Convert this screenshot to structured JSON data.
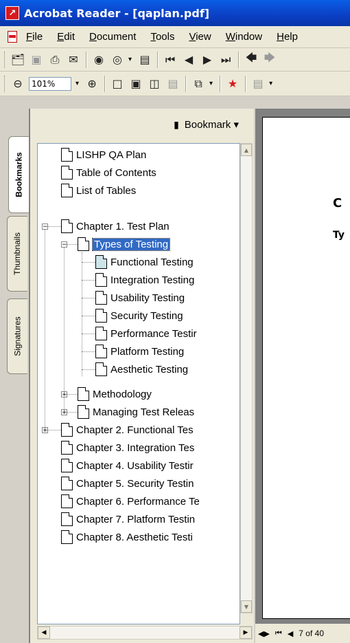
{
  "window": {
    "title": "Acrobat Reader - [qaplan.pdf]"
  },
  "menu": [
    {
      "label": "File",
      "u": "F",
      "rest": "ile"
    },
    {
      "label": "Edit",
      "u": "E",
      "rest": "dit"
    },
    {
      "label": "Document",
      "u": "D",
      "rest": "ocument"
    },
    {
      "label": "Tools",
      "u": "T",
      "rest": "ools"
    },
    {
      "label": "View",
      "u": "V",
      "rest": "iew"
    },
    {
      "label": "Window",
      "u": "W",
      "rest": "indow"
    },
    {
      "label": "Help",
      "u": "H",
      "rest": "elp"
    }
  ],
  "toolbar2": {
    "zoom": "101%"
  },
  "tabs": {
    "bookmarks": "Bookmarks",
    "thumbnails": "Thumbnails",
    "signatures": "Signatures"
  },
  "bookmarks_panel": {
    "menu_label": "Bookmark ▾"
  },
  "bookmarks": [
    {
      "label": "LISHP QA Plan"
    },
    {
      "label": "Table of Contents"
    },
    {
      "label": "List of Tables"
    },
    {
      "label": "Chapter 1. Test Plan"
    },
    {
      "label": "Types of Testing"
    },
    {
      "label": "Functional Testing"
    },
    {
      "label": "Integration Testing"
    },
    {
      "label": "Usability Testing"
    },
    {
      "label": "Security Testing"
    },
    {
      "label": "Performance Testir"
    },
    {
      "label": "Platform Testing"
    },
    {
      "label": "Aesthetic Testing"
    },
    {
      "label": "Methodology"
    },
    {
      "label": "Managing Test Releas"
    },
    {
      "label": "Chapter 2. Functional Tes"
    },
    {
      "label": "Chapter 3. Integration Tes"
    },
    {
      "label": "Chapter 4. Usability Testir"
    },
    {
      "label": "Chapter 5. Security Testin"
    },
    {
      "label": "Chapter 6. Performance Te"
    },
    {
      "label": "Chapter 7. Platform Testin"
    },
    {
      "label": "Chapter 8. Aesthetic Testi"
    }
  ],
  "document": {
    "heading": "C",
    "subheading": "Ty",
    "page_count": "7 of 40"
  }
}
